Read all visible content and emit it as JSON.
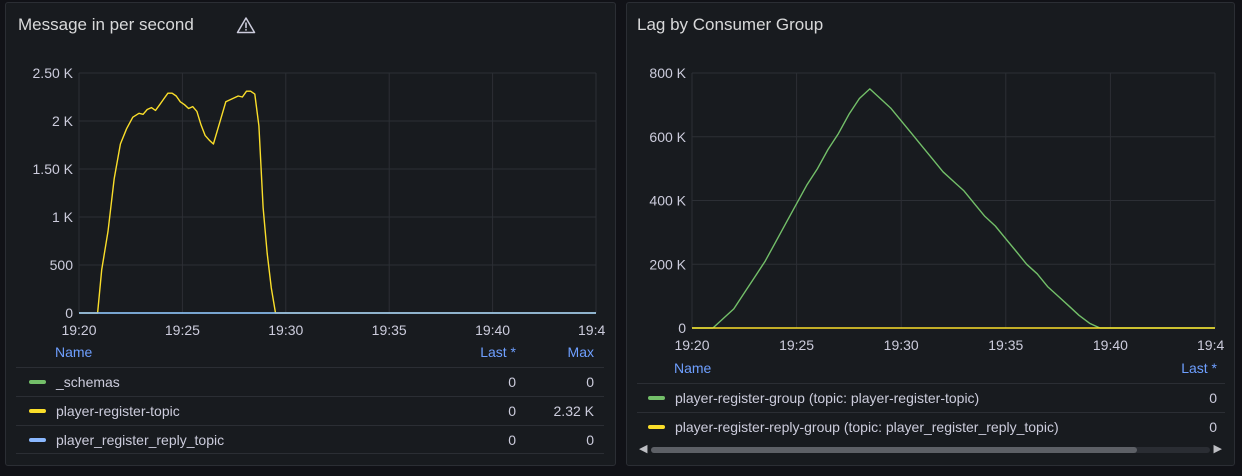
{
  "panels": {
    "left": {
      "title": "Message in per second",
      "warning_icon": "warning-triangle-icon",
      "legend": {
        "headers": {
          "name": "Name",
          "last": "Last *",
          "max": "Max"
        },
        "rows": [
          {
            "name": "_schemas",
            "last": "0",
            "max": "0",
            "color": "#73bf69"
          },
          {
            "name": "player-register-topic",
            "last": "0",
            "max": "2.32 K",
            "color": "#fade2a"
          },
          {
            "name": "player_register_reply_topic",
            "last": "0",
            "max": "0",
            "color": "#8ab8ff"
          }
        ]
      }
    },
    "right": {
      "title": "Lag by Consumer Group",
      "legend": {
        "headers": {
          "name": "Name",
          "last": "Last *"
        },
        "rows": [
          {
            "name": "player-register-group (topic: player-register-topic)",
            "last": "0",
            "color": "#73bf69"
          },
          {
            "name": "player-register-reply-group (topic: player_register_reply_topic)",
            "last": "0",
            "color": "#fade2a"
          }
        ]
      },
      "scrollbar_icons": {
        "left": "arrow-left-icon",
        "right": "arrow-right-icon"
      }
    }
  },
  "chart_data": [
    {
      "type": "line",
      "title": "Message in per second",
      "x_ticks": [
        "19:20",
        "19:25",
        "19:30",
        "19:35",
        "19:40",
        "19:4"
      ],
      "xlim": [
        0,
        25
      ],
      "y_ticks": [
        "0",
        "500",
        "1 K",
        "1.50 K",
        "2 K",
        "2.50 K"
      ],
      "ylim": [
        0,
        2500
      ],
      "grid": true,
      "series": [
        {
          "name": "_schemas",
          "color": "#73bf69",
          "x": [
            0,
            25
          ],
          "y": [
            0,
            0
          ]
        },
        {
          "name": "player-register-topic",
          "color": "#fade2a",
          "x": [
            0,
            0.9,
            1.1,
            1.4,
            1.7,
            2.0,
            2.3,
            2.6,
            2.9,
            3.1,
            3.3,
            3.5,
            3.7,
            3.9,
            4.1,
            4.3,
            4.5,
            4.7,
            4.9,
            5.1,
            5.3,
            5.5,
            5.7,
            5.9,
            6.1,
            6.3,
            6.5,
            6.8,
            7.1,
            7.4,
            7.7,
            7.9,
            8.1,
            8.3,
            8.5,
            8.7,
            8.9,
            9.1,
            9.3,
            9.5,
            9.7,
            9.9,
            10.1,
            25
          ],
          "y": [
            0,
            0,
            450,
            850,
            1400,
            1760,
            1920,
            2040,
            2080,
            2070,
            2120,
            2140,
            2110,
            2170,
            2230,
            2290,
            2290,
            2260,
            2200,
            2170,
            2130,
            2150,
            2100,
            1960,
            1850,
            1800,
            1760,
            1980,
            2200,
            2230,
            2260,
            2250,
            2310,
            2310,
            2280,
            1950,
            1100,
            620,
            260,
            0,
            0,
            0,
            0,
            0
          ]
        },
        {
          "name": "player_register_reply_topic",
          "color": "#8ab8ff",
          "x": [
            0,
            25
          ],
          "y": [
            0,
            0
          ]
        }
      ]
    },
    {
      "type": "line",
      "title": "Lag by Consumer Group",
      "x_ticks": [
        "19:20",
        "19:25",
        "19:30",
        "19:35",
        "19:40",
        "19:4"
      ],
      "xlim": [
        0,
        25
      ],
      "y_ticks": [
        "0",
        "200 K",
        "400 K",
        "600 K",
        "800 K"
      ],
      "ylim": [
        0,
        800000
      ],
      "grid": true,
      "series": [
        {
          "name": "player-register-group (topic: player-register-topic)",
          "color": "#73bf69",
          "x": [
            0,
            1,
            1.5,
            2,
            2.5,
            3,
            3.5,
            4,
            4.5,
            5,
            5.5,
            6,
            6.5,
            7,
            7.5,
            8,
            8.5,
            9,
            9.5,
            10,
            10.5,
            11,
            11.5,
            12,
            12.5,
            13,
            13.5,
            14,
            14.5,
            15,
            15.5,
            16,
            16.5,
            17,
            17.5,
            18,
            18.5,
            19,
            19.5,
            20,
            20.5,
            21,
            25
          ],
          "y": [
            0,
            0,
            30000,
            60000,
            110000,
            160000,
            210000,
            270000,
            330000,
            390000,
            450000,
            500000,
            560000,
            610000,
            670000,
            720000,
            750000,
            720000,
            690000,
            650000,
            610000,
            570000,
            530000,
            490000,
            460000,
            430000,
            390000,
            350000,
            320000,
            280000,
            240000,
            200000,
            170000,
            130000,
            100000,
            70000,
            40000,
            15000,
            0,
            0,
            0,
            0,
            0
          ]
        },
        {
          "name": "player-register-reply-group (topic: player_register_reply_topic)",
          "color": "#fade2a",
          "x": [
            0,
            25
          ],
          "y": [
            0,
            0
          ]
        }
      ]
    }
  ]
}
